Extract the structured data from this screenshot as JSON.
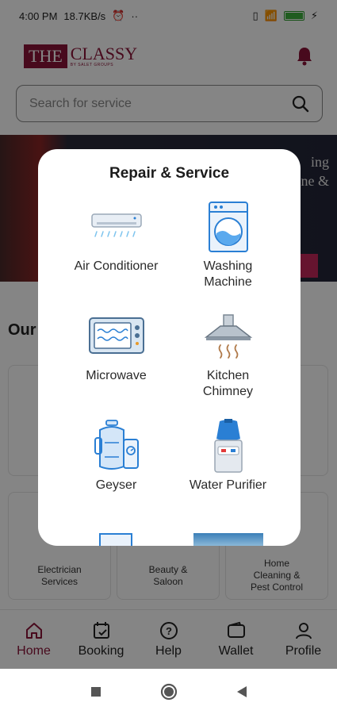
{
  "status_bar": {
    "time": "4:00 PM",
    "speed": "18.7KB/s",
    "dots": "··"
  },
  "header": {
    "logo_the": "THE",
    "logo_classy": "CLASSY",
    "logo_sub": "BY SALET GROUPS",
    "bell_icon": "bell-icon"
  },
  "search": {
    "placeholder": "Search for service",
    "icon": "search-icon"
  },
  "banner": {
    "text_line1": "ing",
    "text_line2": "ne &"
  },
  "section": {
    "title": "Our"
  },
  "categories": [
    {
      "label": "Electrician\nServices"
    },
    {
      "label": "Beauty &\nSaloon"
    },
    {
      "label": "Home\nCleaning &\nPest Control"
    }
  ],
  "modal": {
    "title": "Repair & Service",
    "services": [
      {
        "label": "Air Conditioner",
        "icon": "air-conditioner-icon"
      },
      {
        "label": "Washing Machine",
        "icon": "washing-machine-icon"
      },
      {
        "label": "Microwave",
        "icon": "microwave-icon"
      },
      {
        "label": "Kitchen Chimney",
        "icon": "kitchen-chimney-icon"
      },
      {
        "label": "Geyser",
        "icon": "geyser-icon"
      },
      {
        "label": "Water Purifier",
        "icon": "water-purifier-icon"
      }
    ]
  },
  "bottom_nav": [
    {
      "label": "Home",
      "icon": "home-icon",
      "active": true
    },
    {
      "label": "Booking",
      "icon": "booking-icon",
      "active": false
    },
    {
      "label": "Help",
      "icon": "help-icon",
      "active": false
    },
    {
      "label": "Wallet",
      "icon": "wallet-icon",
      "active": false
    },
    {
      "label": "Profile",
      "icon": "profile-icon",
      "active": false
    }
  ],
  "colors": {
    "brand": "#8b1538",
    "icon_blue": "#2a7fd4",
    "overlay": "rgba(0,0,0,0.48)"
  }
}
